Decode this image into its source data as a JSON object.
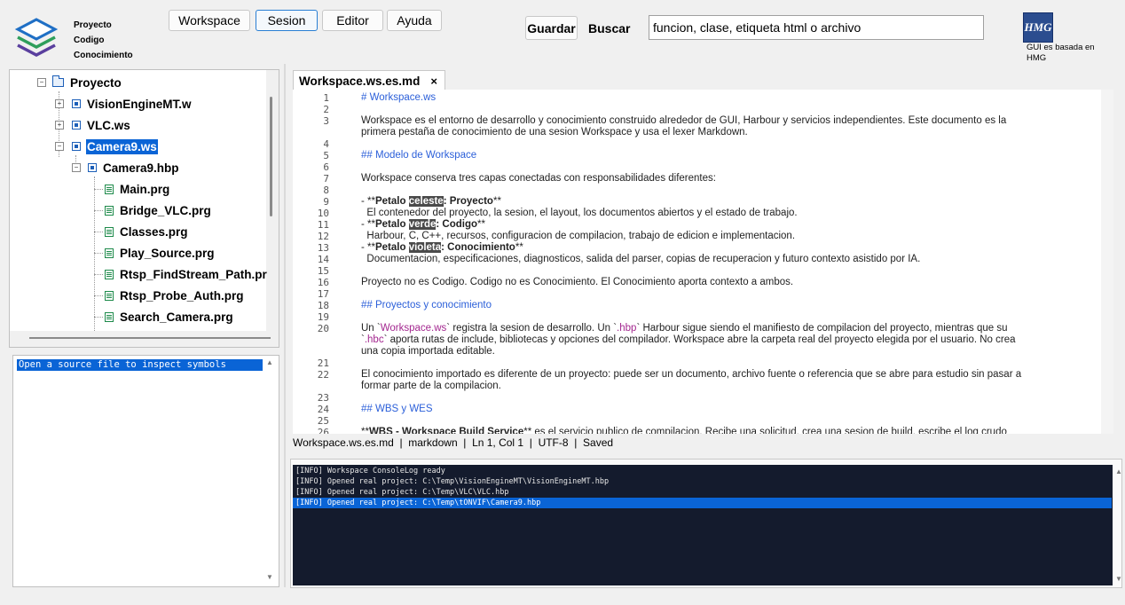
{
  "logo": {
    "lines": [
      "Proyecto",
      "Codigo",
      "Conocimiento"
    ],
    "colors": {
      "blue": "#1f6fc5",
      "green": "#2e9e5b",
      "violet": "#5a3f9e"
    }
  },
  "menu": {
    "workspace": "Workspace",
    "sesion": "Sesion",
    "editor": "Editor",
    "ayuda": "Ayuda"
  },
  "toolbar": {
    "guardar": "Guardar",
    "buscar": "Buscar",
    "search_value": "funcion, clase, etiqueta html o archivo"
  },
  "hmg": {
    "badge": "HMG",
    "caption_line1": "GUI es basada en",
    "caption_line2": "HMG"
  },
  "tree": {
    "root": "Proyecto",
    "items": [
      {
        "label": "VisionEngineMT.w",
        "kind": "ws"
      },
      {
        "label": "VLC.ws",
        "kind": "ws"
      },
      {
        "label": "Camera9.ws",
        "kind": "ws",
        "selected": true
      },
      {
        "label": "Camera9.hbp",
        "kind": "hbp"
      },
      {
        "label": "Main.prg",
        "kind": "prg"
      },
      {
        "label": "Bridge_VLC.prg",
        "kind": "prg"
      },
      {
        "label": "Classes.prg",
        "kind": "prg"
      },
      {
        "label": "Play_Source.prg",
        "kind": "prg"
      },
      {
        "label": "Rtsp_FindStream_Path.pr",
        "kind": "prg"
      },
      {
        "label": "Rtsp_Probe_Auth.prg",
        "kind": "prg"
      },
      {
        "label": "Search_Camera.prg",
        "kind": "prg"
      }
    ]
  },
  "symbols": {
    "message": "Open a source file to inspect symbols"
  },
  "editor_tab": {
    "title": "Workspace.ws.es.md",
    "close": "×"
  },
  "editor": {
    "line_numbers": [
      "1",
      "2",
      "3",
      "4",
      "5",
      "6",
      "7",
      "8",
      "9",
      "10",
      "11",
      "12",
      "13",
      "14",
      "15",
      "16",
      "17",
      "18",
      "19",
      "20",
      "21",
      "22",
      "23",
      "24",
      "25",
      "26"
    ],
    "l1": "# Workspace.ws",
    "l3a": "Workspace es el entorno de desarrollo y conocimiento construido alrededor de GUI, Harbour y servicios independientes. Este documento es la",
    "l3b": "primera pestaña de conocimiento de una sesion Workspace y usa el lexer Markdown.",
    "l5": "## Modelo de Workspace",
    "l7": "Workspace conserva tres capas conectadas con responsabilidades diferentes:",
    "l9_pre": "- **",
    "l9_b1": "Petalo ",
    "l9_hl": "celeste",
    "l9_b2": ": Proyecto",
    "l9_post": "**",
    "l10": "  El contenedor del proyecto, la sesion, el layout, los documentos abiertos y el estado de trabajo.",
    "l11_pre": "- **",
    "l11_b1": "Petalo ",
    "l11_hl": "verde",
    "l11_b2": ": Codigo",
    "l11_post": "**",
    "l12": "  Harbour, C, C++, recursos, configuracion de compilacion, trabajo de edicion e implementacion.",
    "l13_pre": "- **",
    "l13_b1": "Petalo ",
    "l13_hl": "violeta",
    "l13_b2": ": Conocimiento",
    "l13_post": "**",
    "l14": "  Documentacion, especificaciones, diagnosticos, salida del parser, copias de recuperacion y futuro contexto asistido por IA.",
    "l16": "Proyecto no es Codigo. Codigo no es Conocimiento. El Conocimiento aporta contexto a ambos.",
    "l18": "## Proyectos y conocimiento",
    "l20_a": "Un `",
    "l20_b": "Workspace.ws",
    "l20_c": "` registra la sesion de desarrollo. Un `",
    "l20_d": ".hbp",
    "l20_e": "` Harbour sigue siendo el manifiesto de compilacion del proyecto, mientras que su",
    "l20_f": "`",
    "l20_g": ".hbc",
    "l20_h": "` aporta rutas de include, bibliotecas y opciones del compilador. Workspace abre la carpeta real del proyecto elegida por el usuario. No crea",
    "l20_i": "una copia importada editable.",
    "l22a": "El conocimiento importado es diferente de un proyecto: puede ser un documento, archivo fuente o referencia que se abre para estudio sin pasar a",
    "l22b": "formar parte de la compilacion.",
    "l24": "## WBS y WES",
    "l26_pre": "**",
    "l26_b": "WBS - Workspace Build Service",
    "l26_post": "** es el servicio publico de compilacion. Recibe una solicitud, crea una sesion de build, escribe el log crudo"
  },
  "status": {
    "text": "Workspace.ws.es.md  |  markdown  |  Ln 1, Col 1  |  UTF-8  |  Saved"
  },
  "console": {
    "lines": [
      "[INFO] Workspace ConsoleLog ready",
      "[INFO] Opened real project: C:\\Temp\\VisionEngineMT\\VisionEngineMT.hbp",
      "[INFO] Opened real project: C:\\Temp\\VLC\\VLC.hbp",
      "[INFO] Opened real project: C:\\Temp\\tONVIF\\Camera9.hbp"
    ]
  }
}
